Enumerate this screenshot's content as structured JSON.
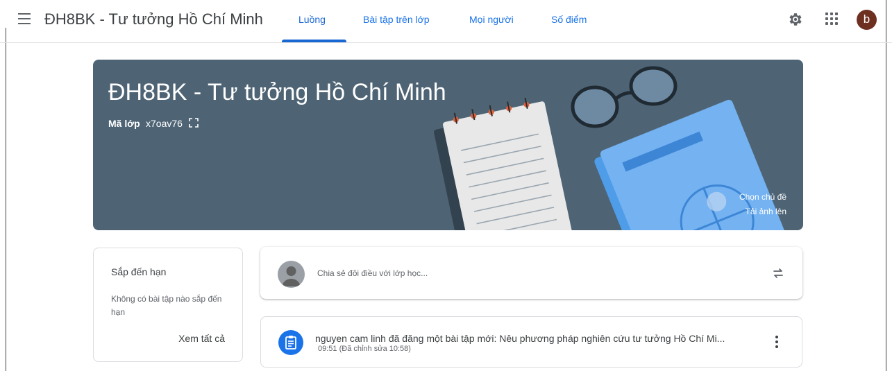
{
  "header": {
    "class_name": "ĐH8BK - Tư tưởng Hồ Chí Minh",
    "tabs": [
      {
        "label": "Luồng",
        "active": true
      },
      {
        "label": "Bài tập trên lớp",
        "active": false
      },
      {
        "label": "Mọi người",
        "active": false
      },
      {
        "label": "Số điểm",
        "active": false
      }
    ],
    "avatar_letter": "b",
    "icons": [
      "menu-icon",
      "gear-icon",
      "apps-icon"
    ]
  },
  "banner": {
    "title": "ĐH8BK - Tư tưởng Hồ Chí Minh",
    "class_code_label": "Mã lớp",
    "class_code": "x7oav76",
    "choose_theme": "Chọn chủ đề",
    "upload_photo": "Tải ảnh lên"
  },
  "upcoming": {
    "title": "Sắp đến hạn",
    "empty_text": "Không có bài tập nào sắp đến hạn",
    "view_all": "Xem tất cả"
  },
  "share_box": {
    "placeholder": "Chia sẻ đôi điều với lớp học..."
  },
  "posts": [
    {
      "text": "nguyen cam linh đã đăng một bài tập mới: Nêu phương pháp nghiên cứu tư tưởng Hồ Chí Mi...",
      "time": "09:51 (Đã chỉnh sửa 10:58)"
    }
  ],
  "colors": {
    "accent": "#1967d2",
    "banner": "#4e6475",
    "avatar": "#6d2f1f"
  }
}
